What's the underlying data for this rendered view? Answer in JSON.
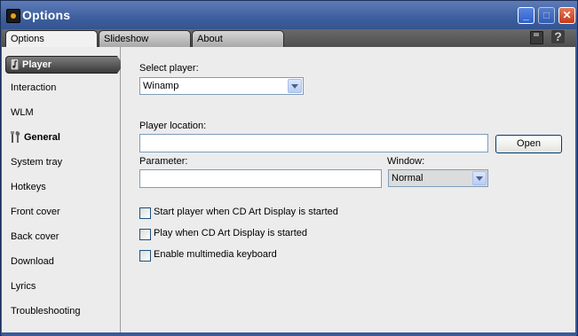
{
  "window": {
    "title": "Options"
  },
  "tabs": [
    {
      "label": "Options",
      "active": true
    },
    {
      "label": "Slideshow",
      "active": false
    },
    {
      "label": "About",
      "active": false
    }
  ],
  "toolbar_icons": [
    "save-icon",
    "help-icon"
  ],
  "sidebar": {
    "items": [
      {
        "label": "Player",
        "active": true,
        "icon": "music-note-icon"
      },
      {
        "label": "Interaction"
      },
      {
        "label": "WLM"
      },
      {
        "label": "General",
        "bold": true,
        "icon": "tools-icon"
      },
      {
        "label": "System tray"
      },
      {
        "label": "Hotkeys"
      },
      {
        "label": "Front cover"
      },
      {
        "label": "Back cover"
      },
      {
        "label": "Download"
      },
      {
        "label": "Lyrics"
      },
      {
        "label": "Troubleshooting"
      }
    ]
  },
  "form": {
    "select_player_label": "Select player:",
    "select_player_value": "Winamp",
    "player_location_label": "Player location:",
    "player_location_value": "",
    "open_button": "Open",
    "parameter_label": "Parameter:",
    "parameter_value": "",
    "window_label": "Window:",
    "window_value": "Normal",
    "checkboxes": [
      {
        "label": "Start player when CD Art Display is started",
        "checked": false
      },
      {
        "label": "Play when CD Art Display is started",
        "checked": false
      },
      {
        "label": "Enable multimedia keyboard",
        "checked": false
      }
    ]
  },
  "colors": {
    "titlebar": "#3d5f9e",
    "panel": "#ececec",
    "active_item": "#3a3a3a"
  }
}
